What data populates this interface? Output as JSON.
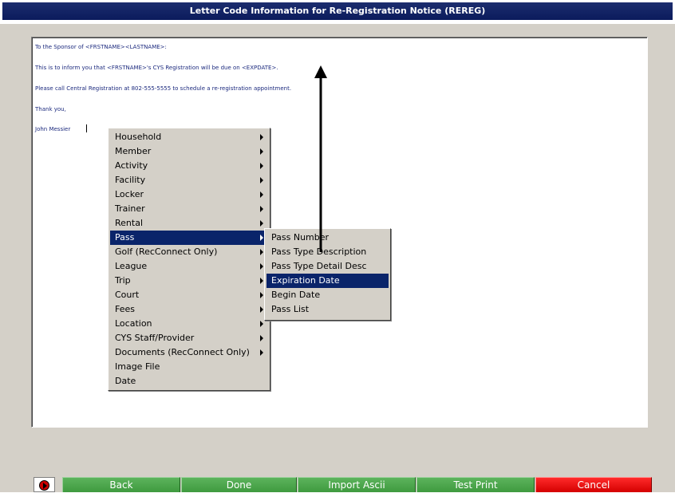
{
  "window": {
    "title": "Letter Code Information for Re-Registration Notice (REREG)"
  },
  "letter": {
    "lines": [
      "To the Sponsor of <FRSTNAME><LASTNAME>:",
      "This is to inform you that <FRSTNAME>'s CYS Registration will be due on <EXPDATE>.",
      "Please call Central Registration at 802-555-5555 to schedule a re-registration appointment.",
      "Thank you,",
      "John Messier"
    ]
  },
  "context_menu": {
    "items": [
      {
        "label": "Household",
        "submenu": true
      },
      {
        "label": "Member",
        "submenu": true
      },
      {
        "label": "Activity",
        "submenu": true
      },
      {
        "label": "Facility",
        "submenu": true
      },
      {
        "label": "Locker",
        "submenu": true
      },
      {
        "label": "Trainer",
        "submenu": true
      },
      {
        "label": "Rental",
        "submenu": true
      },
      {
        "label": "Pass",
        "submenu": true,
        "selected": true
      },
      {
        "label": "Golf (RecConnect Only)",
        "submenu": true
      },
      {
        "label": "League",
        "submenu": true
      },
      {
        "label": "Trip",
        "submenu": true
      },
      {
        "label": "Court",
        "submenu": true
      },
      {
        "label": "Fees",
        "submenu": true
      },
      {
        "label": "Location",
        "submenu": true
      },
      {
        "label": "CYS Staff/Provider",
        "submenu": true
      },
      {
        "label": "Documents (RecConnect Only)",
        "submenu": true
      },
      {
        "label": "Image File",
        "submenu": false
      },
      {
        "label": "Date",
        "submenu": false
      }
    ]
  },
  "submenu": {
    "items": [
      {
        "label": "Pass Number"
      },
      {
        "label": "Pass Type Description"
      },
      {
        "label": "Pass Type Detail Desc"
      },
      {
        "label": "Expiration Date",
        "selected": true
      },
      {
        "label": "Begin Date"
      },
      {
        "label": "Pass List"
      }
    ]
  },
  "buttons": {
    "back": "Back",
    "done": "Done",
    "import_ascii": "Import Ascii",
    "test_print": "Test Print",
    "cancel": "Cancel"
  },
  "colors": {
    "title_bg": "#0b1b5c",
    "selection": "#0a246a",
    "button_green": "#4caa4c",
    "button_red": "#e00000",
    "window_bg": "#d4d0c8"
  }
}
